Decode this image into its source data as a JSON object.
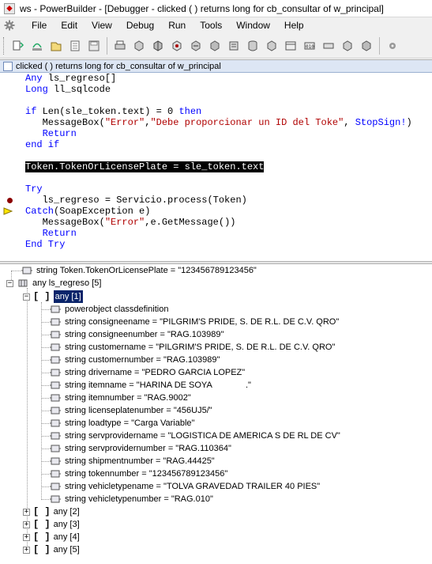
{
  "window": {
    "title": "ws - PowerBuilder - [Debugger - clicked ( )  returns long for cb_consultar of w_principal]"
  },
  "menu": [
    "File",
    "Edit",
    "View",
    "Debug",
    "Run",
    "Tools",
    "Window",
    "Help"
  ],
  "toolbar": {
    "icons": [
      "step-into-icon",
      "step-over-icon",
      "step-out-icon",
      "open-icon",
      "save-icon",
      "print-icon",
      "continue-icon",
      "stop-icon",
      "breakpoint-icon",
      "toggle-icon",
      "watch-icon",
      "variables-icon",
      "database-icon",
      "call-stack-icon",
      "objects-icon",
      "memory-icon",
      "binary-icon",
      "library-icon",
      "editor-icon",
      "settings-icon"
    ]
  },
  "editor": {
    "header": "clicked ( )  returns long for cb_consultar of w_principal",
    "lines": [
      {
        "t": "Any ls_regreso[]"
      },
      {
        "t": "Long ll_sqlcode"
      },
      {
        "t": ""
      },
      {
        "t": "if Len(sle_token.text) = 0 then"
      },
      {
        "t": "   MessageBox(\"Error\",\"Debe proporcionar un ID del Toke\", StopSign!)"
      },
      {
        "t": "   Return"
      },
      {
        "t": "end if"
      },
      {
        "t": ""
      },
      {
        "t": "Token.TokenOrLicensePlate = sle_token.text"
      },
      {
        "t": ""
      },
      {
        "t": "Try"
      },
      {
        "t": "   ls_regreso = Servicio.process(Token)"
      },
      {
        "t": "Catch(SoapException e)"
      },
      {
        "t": "   MessageBox(\"Error\",e.GetMessage())"
      },
      {
        "t": "   Return"
      },
      {
        "t": "End Try"
      }
    ]
  },
  "variables": {
    "token_row": "string Token.TokenOrLicensePlate = \"123456789123456\"",
    "regreso_row": "any ls_regreso  [5]",
    "selected_item": "any [1]",
    "fields": [
      "powerobject classdefinition",
      "string consigneename = \"PILGRIM'S PRIDE, S. DE R.L. DE C.V. QRO\"",
      "string consigneenumber = \"RAG.103989\"",
      "string customername = \"PILGRIM'S PRIDE, S. DE R.L. DE C.V. QRO\"",
      "string customernumber = \"RAG.103989\"",
      "string drivername = \"PEDRO GARCIA LOPEZ\"",
      "string itemname = \"HARINA DE SOYA              .\"",
      "string itemnumber = \"RAG.9002\"",
      "string licenseplatenumber = \"456UJ5/\"",
      "string loadtype = \"Carga Variable\"",
      "string servprovidername = \"LOGISTICA DE AMERICA S DE RL DE CV\"",
      "string servprovidernumber = \"RAG.110364\"",
      "string shipmentnumber = \"RAG.44425\"",
      "string tokennumber = \"123456789123456\"",
      "string vehicletypename = \"TOLVA GRAVEDAD TRAILER 40 PIES\"",
      "string vehicletypenumber = \"RAG.010\""
    ],
    "collapsed": [
      "any [2]",
      "any [3]",
      "any [4]",
      "any [5]"
    ]
  }
}
